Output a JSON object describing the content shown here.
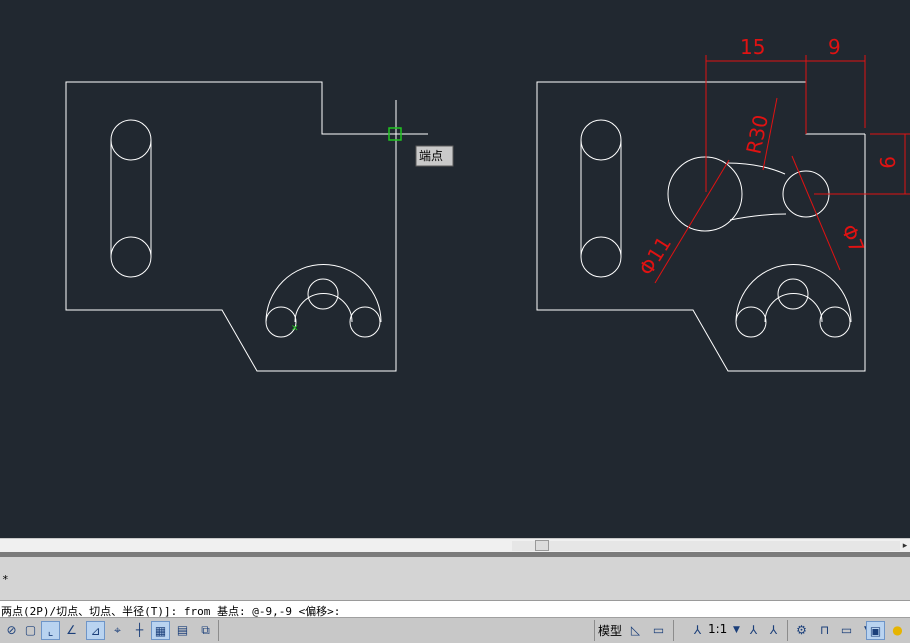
{
  "tooltip": {
    "label": "端点"
  },
  "dimensions": {
    "d15": "15",
    "d9_top": "9",
    "r30": "R30",
    "d9_right": "9",
    "phi11": "Φ11",
    "phi7": "Φ7"
  },
  "command": {
    "history_line": "*",
    "prompt": "两点(2P)/切点、切点、半径(T)]: from 基点: @-9,-9 <偏移>:"
  },
  "statusbar": {
    "model_label": "模型",
    "scale_label": "1:1"
  },
  "icons": [
    "snap-icon",
    "grid-icon",
    "ortho-icon",
    "polar-icon",
    "osnap-icon",
    "otrack-icon",
    "ducs-icon",
    "dyn-icon",
    "lweight-icon",
    "tpy-icon",
    "qp-icon",
    "sc-icon",
    "layout-icon",
    "annotation-scale-icon",
    "annotation-visibility-icon",
    "workspace-icon",
    "lock-icon",
    "hardware-icon",
    "isolate-icon",
    "clean-screen-icon"
  ],
  "colors": {
    "background": "#212830",
    "drawing": "#ffffff",
    "dimension": "#e01212",
    "snap_marker": "#21c421"
  }
}
